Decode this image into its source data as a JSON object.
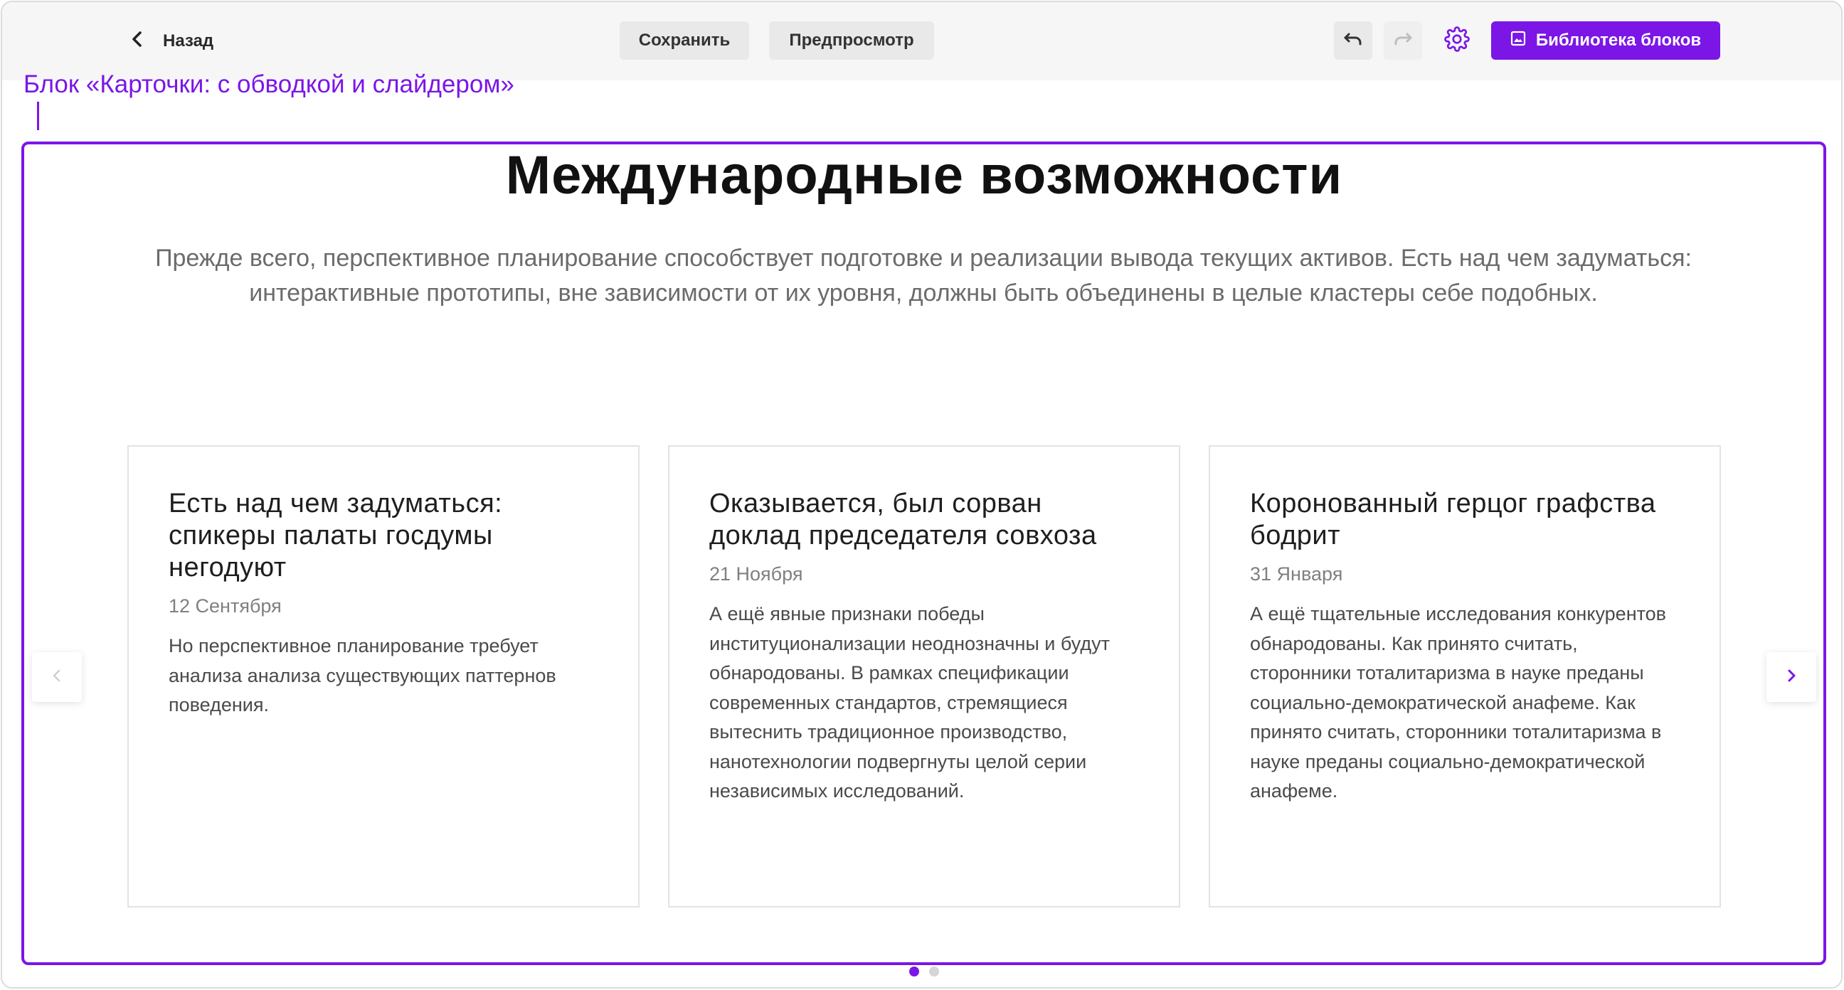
{
  "toolbar": {
    "back_label": "Назад",
    "save_label": "Сохранить",
    "preview_label": "Предпросмотр",
    "library_label": "Библиотека блоков",
    "icons": {
      "back": "chevron-left-icon",
      "undo": "undo-icon",
      "redo": "redo-icon",
      "settings": "gear-icon",
      "library": "image-icon"
    }
  },
  "block": {
    "label": "Блок «Карточки: с обводкой и слайдером»",
    "headline": "Международные возможности",
    "subtitle": "Прежде всего, перспективное планирование способствует подготовке и реализации вывода текущих активов. Есть над чем задуматься: интерактивные прототипы, вне зависимости от их уровня, должны быть объединены в целые кластеры себе подобных."
  },
  "cards": [
    {
      "title": "Есть над чем задуматься: спикеры палаты госдумы негодуют",
      "date": "12 Сентября",
      "text": "Но перспективное планирование требует анализа анализа существующих паттернов поведения."
    },
    {
      "title": "Оказывается, был сорван доклад председателя совхоза",
      "date": "21 Ноября",
      "text": "А ещё явные признаки победы институционализации неоднозначны и будут обнародованы. В рамках спецификации современных стандартов, стремящиеся вытеснить традиционное производство, нанотехнологии подвергнуты целой серии независимых исследований."
    },
    {
      "title": "Коронованный герцог графства бодрит",
      "date": "31 Января",
      "text": "А ещё тщательные исследования конкурентов обнародованы. Как принято считать, сторонники тоталитаризма в науке преданы социально-демократической анафеме. Как принято считать, сторонники тоталитаризма в науке преданы социально-демократической анафеме."
    }
  ],
  "slider": {
    "current_page": 1,
    "total_pages": 2
  },
  "colors": {
    "accent": "#7b16e6",
    "toolbar_bg": "#f6f6f6",
    "button_bg": "#e9e9e9",
    "card_border": "#e3e3e3"
  }
}
